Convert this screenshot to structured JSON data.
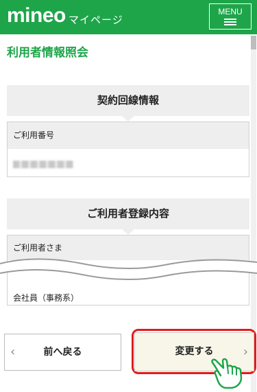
{
  "header": {
    "logo": "mineo",
    "subtitle": "マイページ",
    "menu_label": "MENU",
    "brand_color": "#1ea54a"
  },
  "page_title": "利用者情報照会",
  "contract_section": {
    "heading": "契約回線情報",
    "phone_label": "ご利用番号",
    "phone_value_state": "blurred"
  },
  "user_section": {
    "heading": "ご利用者登録内容",
    "name_label": "ご利用者さま",
    "occupation_value": "会社員（事務系）"
  },
  "actions": {
    "back_label": "前へ戻る",
    "change_label": "変更する",
    "highlight_color": "#e01b1b"
  },
  "icons": [
    "menu-icon",
    "chevron-left-icon",
    "chevron-right-icon",
    "pointing-hand-icon",
    "torn-edge"
  ]
}
